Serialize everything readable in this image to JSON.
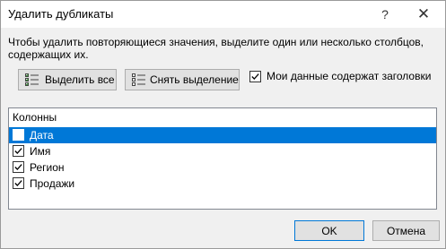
{
  "dialog": {
    "title": "Удалить дубликаты",
    "help_glyph": "?",
    "close_glyph": "✕",
    "description_line1": "Чтобы удалить повторяющиеся значения, выделите один или несколько столбцов,",
    "description_line2": "содержащих их."
  },
  "toolbar": {
    "select_all_label": "Выделить все",
    "deselect_label": "Снять выделение",
    "headers_checkbox_label": "Мои данные содержат заголовки",
    "headers_checkbox_checked": true
  },
  "columns": {
    "header": "Колонны",
    "items": [
      {
        "label": "Дата",
        "checked": false,
        "selected": true
      },
      {
        "label": "Имя",
        "checked": true,
        "selected": false
      },
      {
        "label": "Регион",
        "checked": true,
        "selected": false
      },
      {
        "label": "Продажи",
        "checked": true,
        "selected": false
      }
    ]
  },
  "footer": {
    "ok_label": "OK",
    "cancel_label": "Отмена"
  },
  "colors": {
    "selection": "#0078d7",
    "dialog_bg": "#f0f0f0",
    "button_bg": "#e1e1e1"
  }
}
